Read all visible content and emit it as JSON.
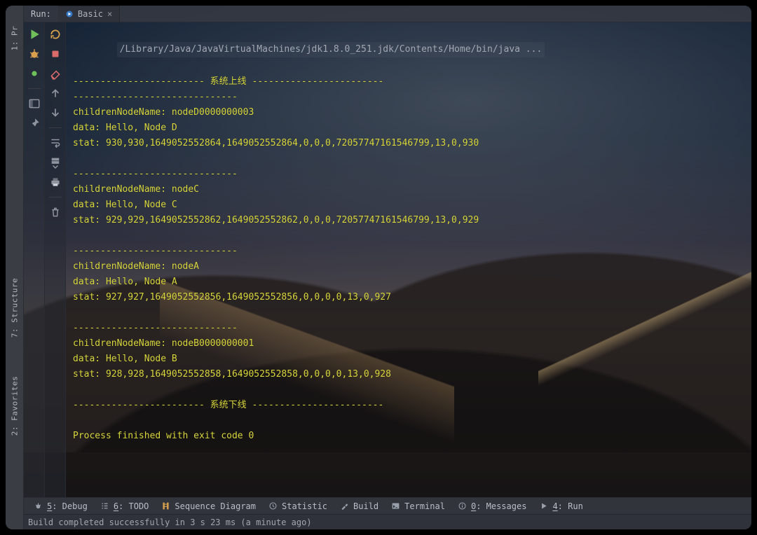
{
  "left_strip": {
    "project": "1: Pr",
    "structure": "7: Structure",
    "favorites": "2: Favorites"
  },
  "tabbar": {
    "title": "Run:",
    "tab_name": "Basic",
    "close_glyph": "×"
  },
  "gutter1_icons": [
    "play",
    "bug",
    "dot",
    "spacer",
    "layout",
    "pin"
  ],
  "gutter2_icons": [
    "rerun",
    "stop",
    "eraser",
    "up-arrow",
    "down-arrow",
    "spacer",
    "tree",
    "export",
    "print",
    "spacer",
    "trash"
  ],
  "console": {
    "cmd": "/Library/Java/JavaVirtualMachines/jdk1.8.0_251.jdk/Contents/Home/bin/java ...",
    "lines": [
      "------------------------ 系统上线 ------------------------",
      "------------------------------",
      "childrenNodeName: nodeD0000000003",
      "data: Hello, Node D",
      "stat: 930,930,1649052552864,1649052552864,0,0,0,72057747161546799,13,0,930",
      "",
      "------------------------------",
      "childrenNodeName: nodeC",
      "data: Hello, Node C",
      "stat: 929,929,1649052552862,1649052552862,0,0,0,72057747161546799,13,0,929",
      "",
      "------------------------------",
      "childrenNodeName: nodeA",
      "data: Hello, Node A",
      "stat: 927,927,1649052552856,1649052552856,0,0,0,0,13,0,927",
      "",
      "------------------------------",
      "childrenNodeName: nodeB0000000001",
      "data: Hello, Node B",
      "stat: 928,928,1649052552858,1649052552858,0,0,0,0,13,0,928",
      "",
      "------------------------ 系统下线 ------------------------",
      "",
      "Process finished with exit code 0"
    ]
  },
  "toolbar": {
    "debug": {
      "num": "5",
      "label": ": Debug"
    },
    "todo": {
      "num": "6",
      "label": ": TODO"
    },
    "seq": {
      "label": "Sequence Diagram"
    },
    "stat": {
      "label": "Statistic"
    },
    "build": {
      "label": "Build"
    },
    "term": {
      "label": "Terminal"
    },
    "msg": {
      "num": "0",
      "label": ": Messages"
    },
    "run": {
      "num": "4",
      "label": ": Run"
    }
  },
  "status": {
    "text": "Build completed successfully in 3 s 23 ms (a minute ago)"
  }
}
